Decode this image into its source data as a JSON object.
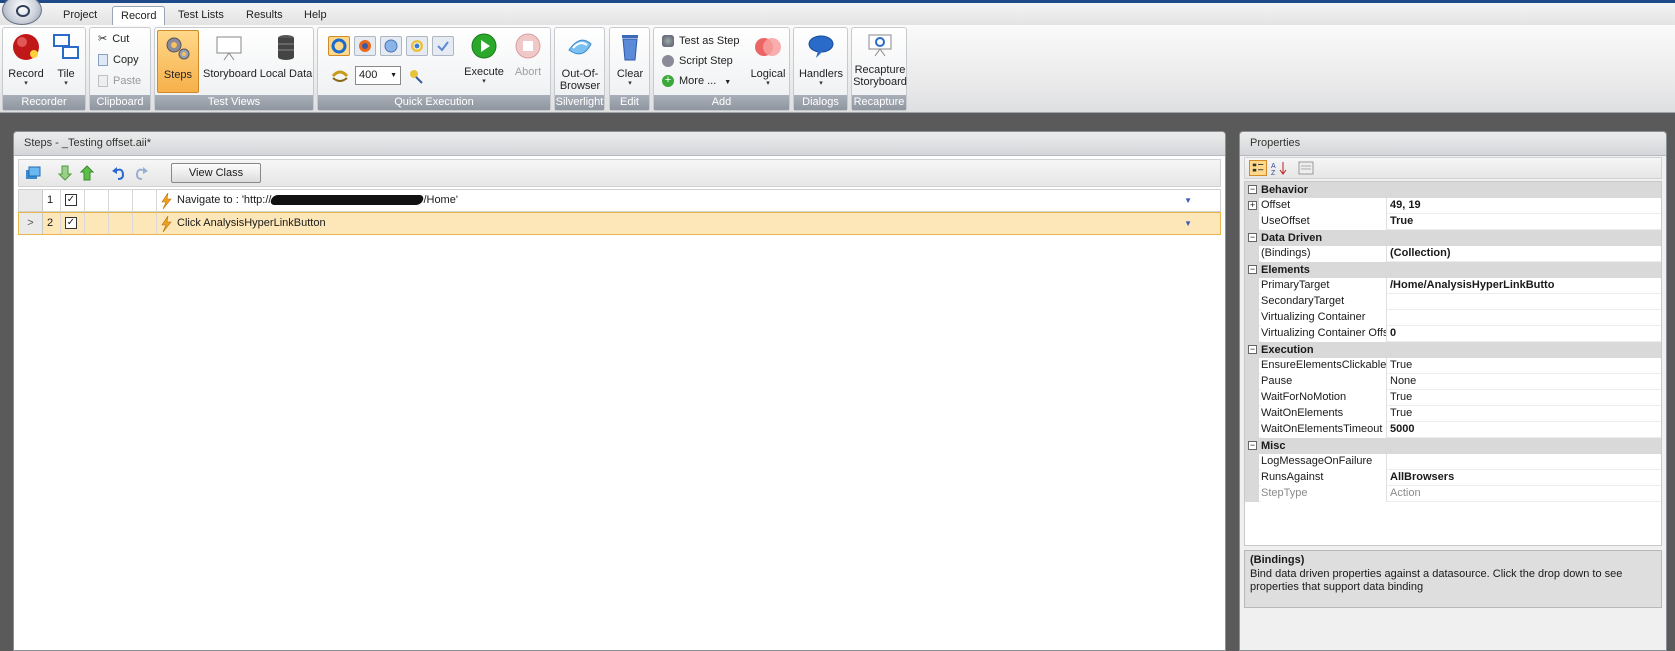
{
  "tabs": [
    "Project",
    "Record",
    "Test Lists",
    "Results",
    "Help"
  ],
  "active_tab": "Record",
  "ribbon": {
    "recorder": {
      "label": "Recorder",
      "record": "Record",
      "tile": "Tile"
    },
    "clipboard": {
      "label": "Clipboard",
      "cut": "Cut",
      "copy": "Copy",
      "paste": "Paste"
    },
    "test_views": {
      "label": "Test Views",
      "steps": "Steps",
      "storyboard": "Storyboard",
      "local_data": "Local Data"
    },
    "quick_execution": {
      "label": "Quick Execution",
      "speed_value": "400",
      "execute": "Execute",
      "abort": "Abort"
    },
    "silverlight": {
      "label": "Silverlight",
      "out_of_browser_1": "Out-Of-",
      "out_of_browser_2": "Browser"
    },
    "edit": {
      "label": "Edit",
      "clear": "Clear"
    },
    "add": {
      "label": "Add",
      "test_as_step": "Test as Step",
      "script_step": "Script Step",
      "more": "More ...",
      "logical": "Logical"
    },
    "dialogs": {
      "label": "Dialogs",
      "handlers": "Handlers"
    },
    "recapture": {
      "label": "Recapture",
      "recapture_1": "Recapture",
      "recapture_2": "Storyboard"
    }
  },
  "steps_panel": {
    "title": "Steps - _Testing offset.aii*",
    "view_class": "View Class",
    "rows": [
      {
        "num": "1",
        "text": "Navigate to : 'http://",
        "text_suffix": "/Home'",
        "selected": false,
        "marker": ""
      },
      {
        "num": "2",
        "text": "Click AnalysisHyperLinkButton",
        "text_suffix": "",
        "selected": true,
        "marker": ">"
      }
    ]
  },
  "properties_panel": {
    "title": "Properties",
    "categories": [
      {
        "name": "Behavior",
        "props": [
          {
            "name": "Offset",
            "value": "49, 19",
            "bold": true,
            "expandable": true
          },
          {
            "name": "UseOffset",
            "value": "True",
            "bold": true
          }
        ]
      },
      {
        "name": "Data Driven",
        "props": [
          {
            "name": "(Bindings)",
            "value": "(Collection)",
            "bold": true
          }
        ]
      },
      {
        "name": "Elements",
        "props": [
          {
            "name": "PrimaryTarget",
            "value": "/Home/AnalysisHyperLinkButto",
            "bold": true
          },
          {
            "name": "SecondaryTarget",
            "value": ""
          },
          {
            "name": "Virtualizing Container",
            "value": ""
          },
          {
            "name": "Virtualizing Container Offs",
            "value": "0",
            "bold": true
          }
        ]
      },
      {
        "name": "Execution",
        "props": [
          {
            "name": "EnsureElementsClickable",
            "value": "True"
          },
          {
            "name": "Pause",
            "value": "None"
          },
          {
            "name": "WaitForNoMotion",
            "value": "True"
          },
          {
            "name": "WaitOnElements",
            "value": "True"
          },
          {
            "name": "WaitOnElementsTimeout",
            "value": "5000",
            "bold": true
          }
        ]
      },
      {
        "name": "Misc",
        "props": [
          {
            "name": "LogMessageOnFailure",
            "value": ""
          },
          {
            "name": "RunsAgainst",
            "value": "AllBrowsers",
            "bold": true
          },
          {
            "name": "StepType",
            "value": "Action",
            "dim": true
          }
        ]
      }
    ],
    "description_title": "(Bindings)",
    "description_text": "Bind data driven properties against a datasource. Click the drop down to see properties that support data binding"
  },
  "colors": {
    "accent": "#1f4a8a",
    "selected_row": "#fde7b8",
    "ribbon_label": "#8f96a0"
  }
}
